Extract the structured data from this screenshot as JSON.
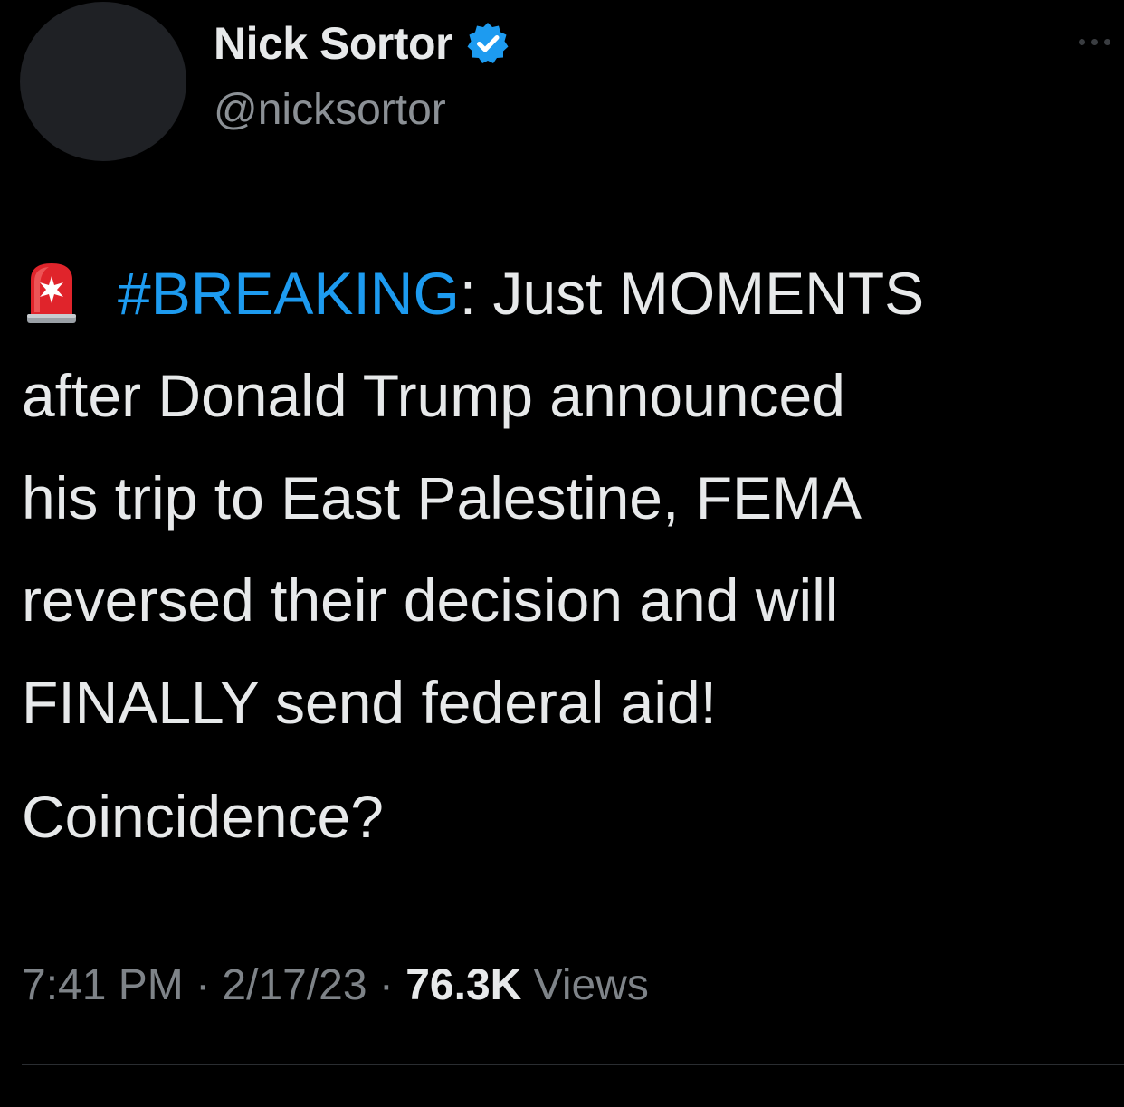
{
  "author": {
    "display_name": "Nick Sortor",
    "handle": "@nicksortor",
    "verified": true,
    "verified_color": "#1d9bf0"
  },
  "tweet": {
    "lines": [
      {
        "prefix_icon": "siren-icon",
        "hashtag": "#BREAKING",
        "text": ": Just MOMENTS"
      },
      {
        "text": "after Donald Trump announced"
      },
      {
        "text": "his trip to East Palestine, FEMA"
      },
      {
        "text": "reversed their decision and will"
      },
      {
        "text": "FINALLY send federal aid!"
      }
    ],
    "question": "Coincidence?",
    "hashtag_color": "#1d9bf0"
  },
  "meta": {
    "time": "7:41 PM",
    "separator": " · ",
    "date": "2/17/23",
    "views_count": "76.3K",
    "views_label": " Views"
  }
}
